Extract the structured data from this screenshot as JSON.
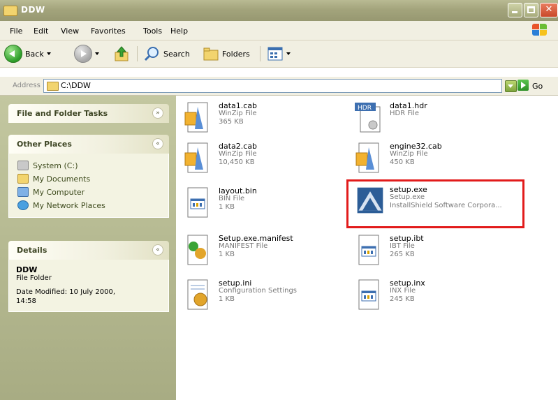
{
  "window": {
    "title": "DDW"
  },
  "menu": [
    "File",
    "Edit",
    "View",
    "Favorites",
    "Tools",
    "Help"
  ],
  "toolbar": {
    "back": "Back",
    "search": "Search",
    "folders": "Folders"
  },
  "address": {
    "label": "Address",
    "path": "C:\\DDW",
    "go": "Go"
  },
  "sidebar": {
    "file_tasks": {
      "title": "File and Folder Tasks"
    },
    "other_places": {
      "title": "Other Places",
      "items": [
        "System (C:)",
        "My Documents",
        "My Computer",
        "My Network Places"
      ]
    },
    "details": {
      "title": "Details",
      "name": "DDW",
      "type": "File Folder",
      "modified": "Date Modified: 10 July 2000, 14:58"
    }
  },
  "files": [
    {
      "name": "data1.cab",
      "type": "WinZip File",
      "size": "365 KB",
      "icon": "winzip-icon"
    },
    {
      "name": "data1.hdr",
      "type": "HDR File",
      "size": "",
      "icon": "hdr-icon"
    },
    {
      "name": "data2.cab",
      "type": "WinZip File",
      "size": "10,450 KB",
      "icon": "winzip-icon"
    },
    {
      "name": "engine32.cab",
      "type": "WinZip File",
      "size": "450 KB",
      "icon": "winzip-icon"
    },
    {
      "name": "layout.bin",
      "type": "BIN File",
      "size": "1 KB",
      "icon": "bin-icon"
    },
    {
      "name": "setup.exe",
      "type": "Setup.exe",
      "size": "InstallShield Software Corpora...",
      "icon": "installshield-icon"
    },
    {
      "name": "Setup.exe.manifest",
      "type": "MANIFEST File",
      "size": "1 KB",
      "icon": "manifest-icon"
    },
    {
      "name": "setup.ibt",
      "type": "IBT File",
      "size": "265 KB",
      "icon": "ibt-icon"
    },
    {
      "name": "setup.ini",
      "type": "Configuration Settings",
      "size": "1 KB",
      "icon": "ini-icon"
    },
    {
      "name": "setup.inx",
      "type": "INX File",
      "size": "245 KB",
      "icon": "inx-icon"
    }
  ],
  "colors": {
    "highlight": "#e21b1b",
    "sidebar": "#b7ba92",
    "titlebar": "#a3a47c"
  }
}
